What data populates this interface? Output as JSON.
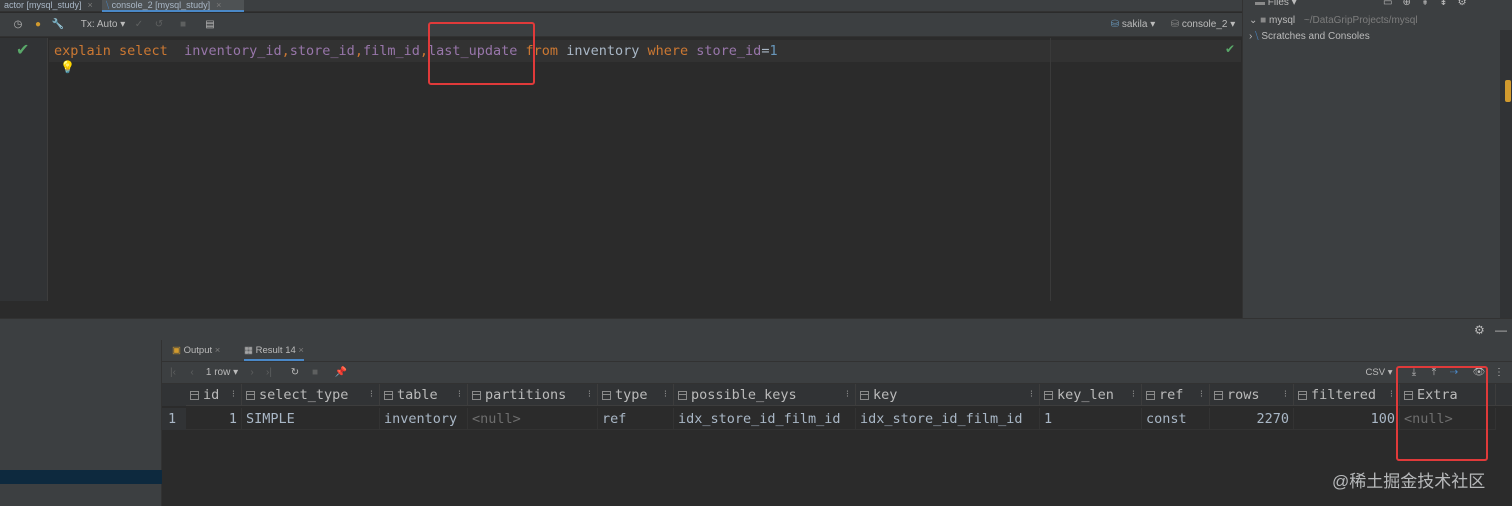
{
  "tabs": [
    {
      "label": "actor [mysql_study]",
      "close": "×"
    },
    {
      "label": "console_2 [mysql_study]",
      "close": "×"
    }
  ],
  "toolbar": {
    "tx_mode": "Tx: Auto",
    "schema": "sakila",
    "session": "console_2"
  },
  "editor": {
    "tokens": [
      {
        "t": "explain",
        "c": "kw"
      },
      {
        "t": " ",
        "c": "tx"
      },
      {
        "t": "select",
        "c": "kw"
      },
      {
        "t": "  ",
        "c": "tx"
      },
      {
        "t": "inventory_id",
        "c": "id"
      },
      {
        "t": ",",
        "c": "kw"
      },
      {
        "t": "store_id",
        "c": "id"
      },
      {
        "t": ",",
        "c": "kw"
      },
      {
        "t": "film_id",
        "c": "id"
      },
      {
        "t": ",",
        "c": "kw"
      },
      {
        "t": "last_update",
        "c": "id"
      },
      {
        "t": " ",
        "c": "tx"
      },
      {
        "t": "from",
        "c": "kw"
      },
      {
        "t": " ",
        "c": "tx"
      },
      {
        "t": "inventory",
        "c": "tx"
      },
      {
        "t": " ",
        "c": "tx"
      },
      {
        "t": "where",
        "c": "kw"
      },
      {
        "t": " ",
        "c": "tx"
      },
      {
        "t": "store_id",
        "c": "id"
      },
      {
        "t": "=",
        "c": "op"
      },
      {
        "t": "1",
        "c": "num"
      }
    ]
  },
  "files_panel": {
    "title": "Files",
    "project_name": "mysql",
    "project_path": "~/DataGripProjects/mysql",
    "scratches": "Scratches and Consoles"
  },
  "results": {
    "tabs": [
      {
        "label": "Output"
      },
      {
        "label": "Result 14"
      }
    ],
    "row_count": "1 row",
    "export_format": "CSV",
    "columns": [
      "id",
      "select_type",
      "table",
      "partitions",
      "type",
      "possible_keys",
      "key",
      "key_len",
      "ref",
      "rows",
      "filtered",
      "Extra"
    ],
    "rows": [
      {
        "num": "1",
        "cells": [
          "1",
          "SIMPLE",
          "inventory",
          "<null>",
          "ref",
          "idx_store_id_film_id",
          "idx_store_id_film_id",
          "1",
          "const",
          "2270",
          "100",
          "<null>"
        ]
      }
    ]
  },
  "watermark": "@稀土掘金技术社区",
  "colors": {
    "highlight": "#e03a3a",
    "keyword": "#cc7832",
    "identifier": "#9876aa",
    "number": "#6897bb",
    "accent": "#4a88c7"
  }
}
